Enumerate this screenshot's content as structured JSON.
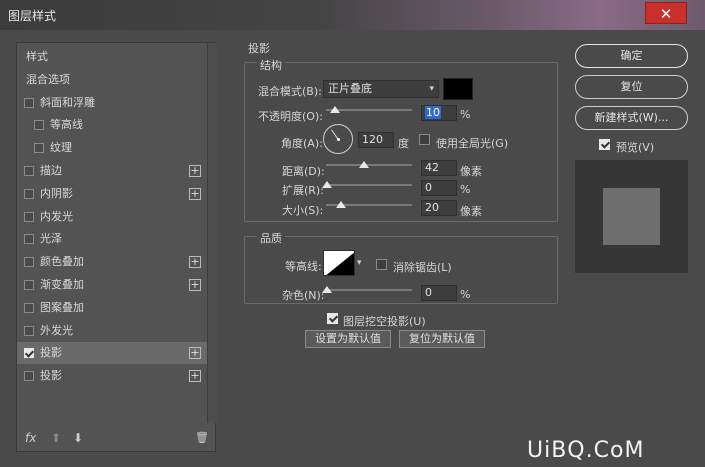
{
  "window": {
    "title": "图层样式",
    "close_glyph": "✕"
  },
  "left_panel": {
    "items": [
      {
        "label": "样式",
        "checkbox": false,
        "plus": false,
        "indent": 0,
        "checked": false
      },
      {
        "label": "混合选项",
        "checkbox": false,
        "plus": false,
        "indent": 0,
        "checked": false
      },
      {
        "label": "斜面和浮雕",
        "checkbox": true,
        "plus": false,
        "indent": 0,
        "checked": false
      },
      {
        "label": "等高线",
        "checkbox": true,
        "plus": false,
        "indent": 1,
        "checked": false
      },
      {
        "label": "纹理",
        "checkbox": true,
        "plus": false,
        "indent": 1,
        "checked": false
      },
      {
        "label": "描边",
        "checkbox": true,
        "plus": true,
        "indent": 0,
        "checked": false
      },
      {
        "label": "内阴影",
        "checkbox": true,
        "plus": true,
        "indent": 0,
        "checked": false
      },
      {
        "label": "内发光",
        "checkbox": true,
        "plus": false,
        "indent": 0,
        "checked": false
      },
      {
        "label": "光泽",
        "checkbox": true,
        "plus": false,
        "indent": 0,
        "checked": false
      },
      {
        "label": "颜色叠加",
        "checkbox": true,
        "plus": true,
        "indent": 0,
        "checked": false
      },
      {
        "label": "渐变叠加",
        "checkbox": true,
        "plus": true,
        "indent": 0,
        "checked": false
      },
      {
        "label": "图案叠加",
        "checkbox": true,
        "plus": false,
        "indent": 0,
        "checked": false
      },
      {
        "label": "外发光",
        "checkbox": true,
        "plus": false,
        "indent": 0,
        "checked": false
      },
      {
        "label": "投影",
        "checkbox": true,
        "plus": true,
        "indent": 0,
        "checked": true,
        "selected": true
      },
      {
        "label": "投影",
        "checkbox": true,
        "plus": true,
        "indent": 0,
        "checked": false
      }
    ],
    "plus_glyph": "+",
    "footer": {
      "fx": "fx",
      "up": "⬆",
      "down": "⬇",
      "trash": "🗑"
    }
  },
  "drop_shadow": {
    "section_title": "投影",
    "structure_title": "结构",
    "blend_mode_label": "混合模式(B):",
    "blend_mode_value": "正片叠底",
    "blend_color": "#000000",
    "opacity_label": "不透明度(O):",
    "opacity_value": "10",
    "opacity_unit": "%",
    "angle_label": "角度(A):",
    "angle_value": "120",
    "angle_unit": "度",
    "global_light_label": "使用全局光(G)",
    "distance_label": "距离(D):",
    "distance_value": "42",
    "distance_unit": "像素",
    "spread_label": "扩展(R):",
    "spread_value": "0",
    "spread_unit": "%",
    "size_label": "大小(S):",
    "size_value": "20",
    "size_unit": "像素",
    "quality_title": "品质",
    "contour_label": "等高线:",
    "antialias_label": "消除锯齿(L)",
    "noise_label": "杂色(N):",
    "noise_value": "0",
    "noise_unit": "%",
    "knockout_label": "图层挖空投影(U)",
    "set_default_label": "设置为默认值",
    "reset_default_label": "复位为默认值",
    "dropdown_glyph": "▾"
  },
  "right_panel": {
    "ok_label": "确定",
    "reset_label": "复位",
    "new_style_label": "新建样式(W)...",
    "preview_label": "预览(V)"
  },
  "watermark": "UiBQ.CoM"
}
